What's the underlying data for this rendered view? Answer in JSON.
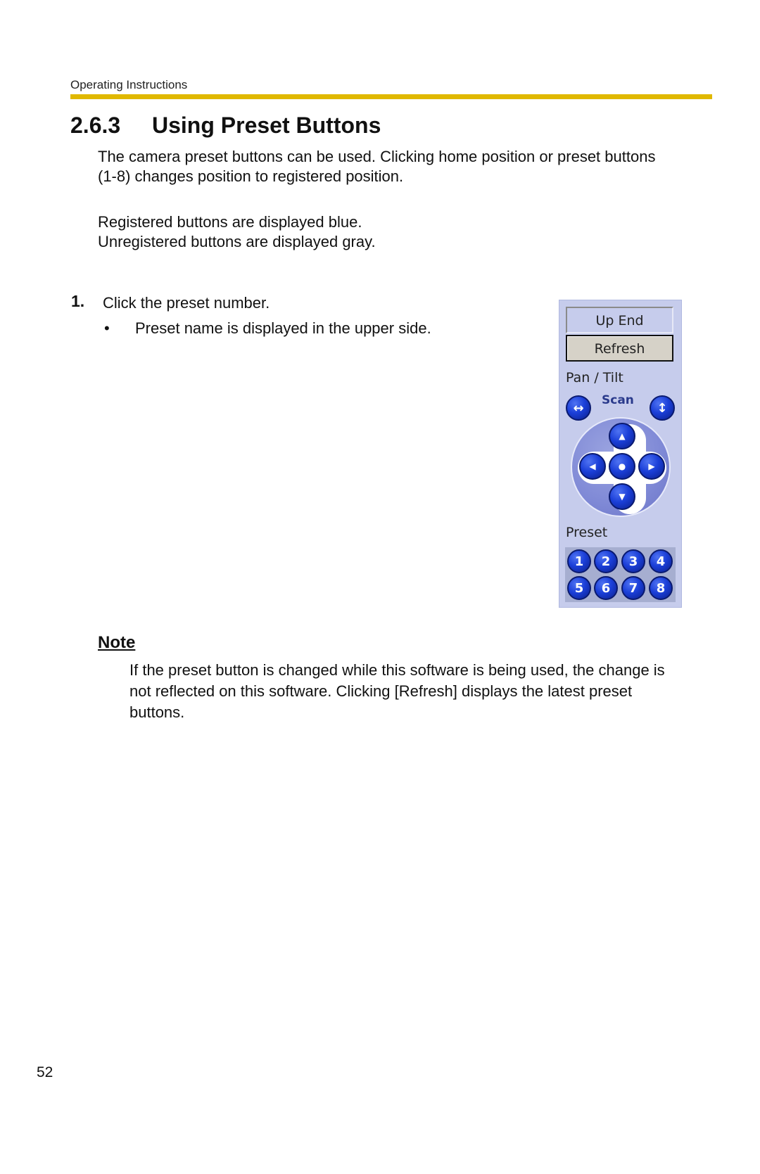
{
  "header": {
    "running_title": "Operating Instructions",
    "rule_color": "#e0b800"
  },
  "section": {
    "number": "2.6.3",
    "title": "Using Preset Buttons"
  },
  "intro": {
    "line1": "The camera preset buttons can be used. Clicking home position or preset buttons",
    "line2": "(1-8) changes position to registered position.",
    "line3": "Registered buttons are displayed blue.",
    "line4": "Unregistered buttons are displayed gray."
  },
  "steps": [
    {
      "number": "1.",
      "text": "Click the preset number.",
      "bullets": [
        {
          "marker": "•",
          "text": "Preset name is displayed in the upper side."
        }
      ]
    }
  ],
  "panel": {
    "background": "#c6ccec",
    "up_end_label": "Up End",
    "refresh_label": "Refresh",
    "pan_tilt_label": "Pan / Tilt",
    "scan_label": "Scan",
    "scan_horizontal_icon": "↔",
    "scan_vertical_icon": "↕",
    "dpad": {
      "up": "▲",
      "left": "◀",
      "home": "●",
      "right": "▶",
      "down": "▼"
    },
    "preset_label": "Preset",
    "presets": [
      "1",
      "2",
      "3",
      "4",
      "5",
      "6",
      "7",
      "8"
    ],
    "registered_color": "#1b3fd8"
  },
  "note": {
    "title": "Note",
    "line1": "If the preset button is changed while this software is being used, the change is",
    "line2": "not reflected on this software. Clicking [Refresh] displays the latest preset",
    "line3": "buttons."
  },
  "footer": {
    "page_number": "52"
  }
}
